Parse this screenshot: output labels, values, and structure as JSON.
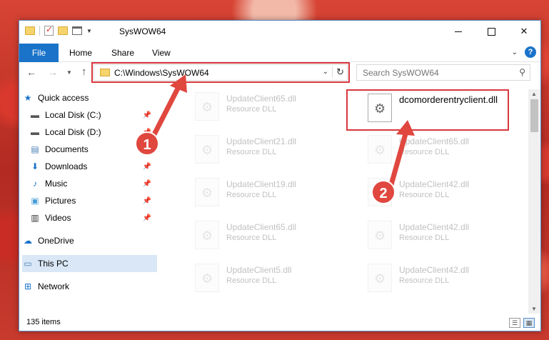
{
  "window": {
    "title": "SysWOW64"
  },
  "ribbon": {
    "tabs": [
      "File",
      "Home",
      "Share",
      "View"
    ],
    "help": "?"
  },
  "nav": {
    "address": "C:\\Windows\\SysWOW64",
    "search_placeholder": "Search SysWOW64"
  },
  "sidebar": {
    "items": [
      {
        "label": "Quick access",
        "icon": "star-icon",
        "pinned": false
      },
      {
        "label": "Local Disk (C:)",
        "icon": "drive-icon",
        "pinned": true
      },
      {
        "label": "Local Disk (D:)",
        "icon": "drive-icon",
        "pinned": true
      },
      {
        "label": "Documents",
        "icon": "documents-icon",
        "pinned": true
      },
      {
        "label": "Downloads",
        "icon": "download-icon",
        "pinned": true
      },
      {
        "label": "Music",
        "icon": "music-icon",
        "pinned": true
      },
      {
        "label": "Pictures",
        "icon": "pictures-icon",
        "pinned": true
      },
      {
        "label": "Videos",
        "icon": "videos-icon",
        "pinned": true
      },
      {
        "label": "OneDrive",
        "icon": "cloud-icon",
        "pinned": false
      },
      {
        "label": "This PC",
        "icon": "computer-icon",
        "pinned": false,
        "selected": true
      },
      {
        "label": "Network",
        "icon": "network-icon",
        "pinned": false
      }
    ]
  },
  "files": {
    "highlighted": {
      "name": "dcomorderentryclient.dll"
    },
    "left_column": [
      {
        "name": "UpdateClient65.dll",
        "type": "Resource DLL"
      },
      {
        "name": "UpdateClient21.dll",
        "type": "Resource DLL"
      },
      {
        "name": "UpdateClient19.dll",
        "type": "Resource DLL"
      },
      {
        "name": "UpdateClient65.dll",
        "type": "Resource DLL"
      },
      {
        "name": "UpdateClient5.dll",
        "type": "Resource DLL"
      }
    ],
    "right_column": [
      {
        "name": "UpdateClient65.dll",
        "type": "Resource DLL"
      },
      {
        "name": "UpdateClient42.dll",
        "type": "Resource DLL"
      },
      {
        "name": "UpdateClient42.dll",
        "type": "Resource DLL"
      },
      {
        "name": "UpdateClient42.dll",
        "type": "Resource DLL"
      }
    ]
  },
  "status": {
    "count": "135 items"
  },
  "annotations": {
    "badge1": "1",
    "badge2": "2"
  },
  "colors": {
    "accent": "#1a73c9",
    "highlight": "#d9363e",
    "selection": "#d9e7f6"
  }
}
